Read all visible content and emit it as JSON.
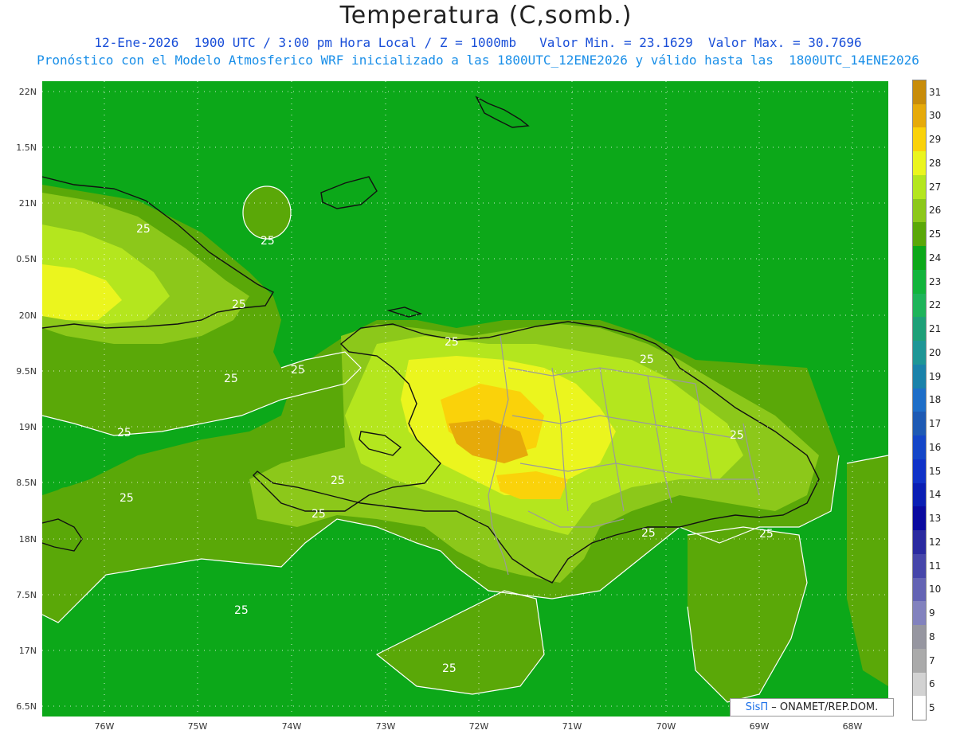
{
  "header": {
    "title": "Temperatura (C,somb.)",
    "subtitle1": "12-Ene-2026  1900 UTC / 3:00 pm Hora Local / Z = 1000mb   Valor Min. = 23.1629  Valor Max. = 30.7696",
    "subtitle2": "Pronóstico con el Modelo Atmosferico WRF inicializado a las 1800UTC_12ENE2026 y válido hasta las  1800UTC_14ENE2026"
  },
  "map": {
    "lat_labels": [
      "22N",
      "1.5N",
      "21N",
      "0.5N",
      "20N",
      "9.5N",
      "19N",
      "8.5N",
      "18N",
      "7.5N",
      "17N",
      "6.5N"
    ],
    "lon_labels": [
      "76W",
      "75W",
      "74W",
      "73W",
      "72W",
      "71W",
      "70W",
      "69W",
      "68W"
    ],
    "contour_label": "25",
    "colors": {
      "ocean": "#0ca819",
      "t25": "#5aa808",
      "t26": "#8cc81a",
      "t27": "#b4e61e",
      "t28": "#ebf51e",
      "t29": "#fad20a",
      "t30": "#e6aa0a",
      "t31": "#c88c0a",
      "coast": "#111111",
      "province": "#9a9a9a"
    }
  },
  "colorbar": {
    "labels": [
      "31",
      "30",
      "29",
      "28",
      "27",
      "26",
      "25",
      "24",
      "23",
      "22",
      "21",
      "20",
      "19",
      "18",
      "17",
      "16",
      "15",
      "14",
      "13",
      "12",
      "11",
      "10",
      "9",
      "8",
      "7",
      "6",
      "5"
    ],
    "colors": [
      "#c88c0a",
      "#e6aa0a",
      "#fad20a",
      "#ebf51e",
      "#b4e61e",
      "#8cc81a",
      "#5aa808",
      "#0ca819",
      "#12b43c",
      "#1eb45a",
      "#1ea078",
      "#1e9696",
      "#1a82aa",
      "#1e6ec8",
      "#1e5ab4",
      "#1446c8",
      "#1032c8",
      "#0a1eb4",
      "#0a0aa0",
      "#2a2aa0",
      "#4646aa",
      "#6464b4",
      "#8282be",
      "#9696a0",
      "#aaaaaa",
      "#d2d2d2",
      "#ffffff"
    ]
  },
  "credit": {
    "sis": "SisΠ",
    "text": "– ONAMET/REP.DOM."
  }
}
